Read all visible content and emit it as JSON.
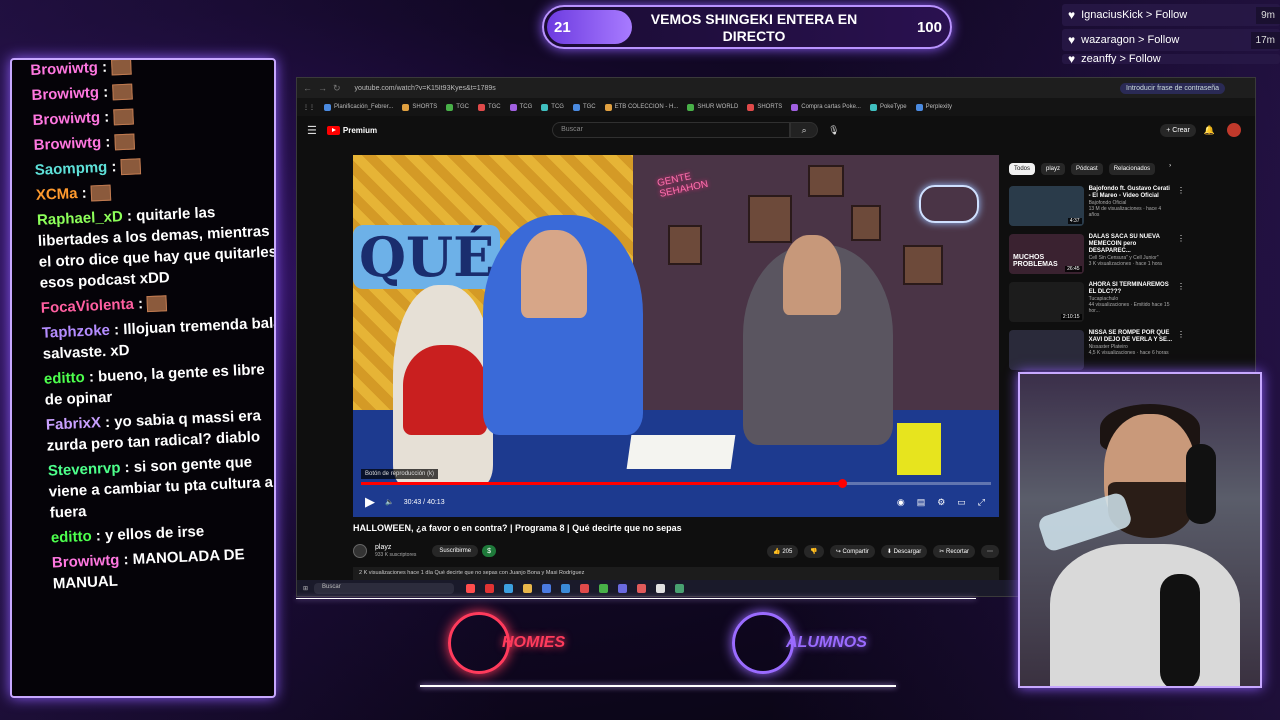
{
  "counter": {
    "current": "21",
    "title": "VEMOS SHINGEKI ENTERA EN DIRECTO",
    "goal": "100",
    "progress_fraction": 0.21
  },
  "follows": [
    {
      "name": "IgnaciusKick > Follow",
      "ago": "9m"
    },
    {
      "name": "wazaragon > Follow",
      "ago": "17m"
    },
    {
      "name": "zeanffy > Follow",
      "ago": ""
    }
  ],
  "chat": [
    {
      "user": "Browiwtg",
      "color": "#ff77e0",
      "text": "",
      "emote": true
    },
    {
      "user": "Browiwtg",
      "color": "#ff77e0",
      "text": "",
      "emote": true
    },
    {
      "user": "Browiwtg",
      "color": "#ff77e0",
      "text": "",
      "emote": true
    },
    {
      "user": "Browiwtg",
      "color": "#ff77e0",
      "text": "",
      "emote": true
    },
    {
      "user": "Saompmg",
      "color": "#5ee0d8",
      "text": "",
      "emote": true
    },
    {
      "user": "XCMa",
      "color": "#ff9a2e",
      "text": "",
      "emote": true
    },
    {
      "user": "Raphael_xD",
      "color": "#8dff5a",
      "text": "quitarle las libertades a los demas, mientras el otro dice que hay que quitarles esos podcast xDD",
      "emote": false
    },
    {
      "user": "FocaViolenta",
      "color": "#ff5fa0",
      "text": "",
      "emote": true
    },
    {
      "user": "Taphzoke",
      "color": "#b48cff",
      "text": "Illojuan tremenda bala salvaste. xD",
      "emote": false
    },
    {
      "user": "editto",
      "color": "#4dff4d",
      "text": "bueno, la gente es libre de opinar",
      "emote": false
    },
    {
      "user": "FabrixX",
      "color": "#c9a0ff",
      "text": "yo sabia q massi era zurda pero tan radical? diablo",
      "emote": false
    },
    {
      "user": "Stevenrvp",
      "color": "#4dff8a",
      "text": "si son gente que viene a cambiar tu pta cultura a fuera",
      "emote": false
    },
    {
      "user": "editto",
      "color": "#4dff4d",
      "text": "y ellos de irse",
      "emote": false
    },
    {
      "user": "Browiwtg",
      "color": "#ff77e0",
      "text": "MANOLADA DE MANUAL",
      "emote": false
    }
  ],
  "browser": {
    "url": "youtube.com/watch?v=K15It93Kyes&t=1789s",
    "password_prompt": "Introducir frase de contraseña",
    "bookmarks": [
      "Planificación_Febrer...",
      "SHORTS",
      "TGC",
      "TGC",
      "TCG",
      "TCG",
      "TGC",
      "ETB COLECCION - H...",
      "SHUR WORLD",
      "SHORTS",
      "Compra cartas Poke...",
      "PokeType",
      "Perplexity"
    ]
  },
  "youtube": {
    "logo": "Premium",
    "search_placeholder": "Buscar",
    "create_label": "+ Crear",
    "video_title": "HALLOWEEN, ¿a favor o en contra? | Programa 8 | Qué decirte que no sepas",
    "time": "30:43 / 40:13",
    "progress_fraction": 0.764,
    "tooltip": "Botón de reproducción (k)",
    "channel": "playz",
    "subscribers": "933 K suscriptores",
    "subscribe_label": "Suscribirme",
    "likes": "205",
    "share_label": "Compartir",
    "download_label": "Descargar",
    "clip_label": "Recortar",
    "description": "2 K visualizaciones  hace 1 día  Qué decirte que no sepas con Juanjo Bona y Masi Rodríguez",
    "chips": [
      "Todos",
      "playz",
      "Pódcast",
      "Relacionados"
    ],
    "recs": [
      {
        "title": "Bajofondo ft. Gustavo Cerati - El Mareo - Video Oficial",
        "channel": "Bajofondo Oficial",
        "meta": "13 M de visualizaciones · hace 4 años",
        "duration": "4:37",
        "color": "#2a3b4a"
      },
      {
        "title": "DALAS SACA SU NUEVA MEMECOIN pero DESAPAREC...",
        "channel": "Cell Sin Censura\" y Cell Junior\"",
        "meta": "3 K visualizaciones · hace 1 hora",
        "duration": "26:45",
        "color": "#3a2230",
        "thumb_text": "MUCHOS PROBLEMAS"
      },
      {
        "title": "AHORA SI TERMINAREMOS EL DLC???",
        "channel": "Tucapiachulo",
        "meta": "44 visualizaciones · Emitido hace 15 hor...",
        "duration": "2:10:15",
        "color": "#1c1c1c"
      },
      {
        "title": "NISSA SE ROMPE POR QUE XAVI DEJO DE VERLA Y SE...",
        "channel": "Nissaster Plateiro",
        "meta": "4,5 K visualizaciones · hace 6 horas",
        "duration": "",
        "color": "#2a2a3a"
      }
    ]
  },
  "taskbar": {
    "search_placeholder": "Buscar"
  },
  "logos": [
    {
      "word": "HOMIES",
      "color": "#ff3b5c"
    },
    {
      "word": "ALUMNOS",
      "color": "#9a6bff"
    }
  ]
}
